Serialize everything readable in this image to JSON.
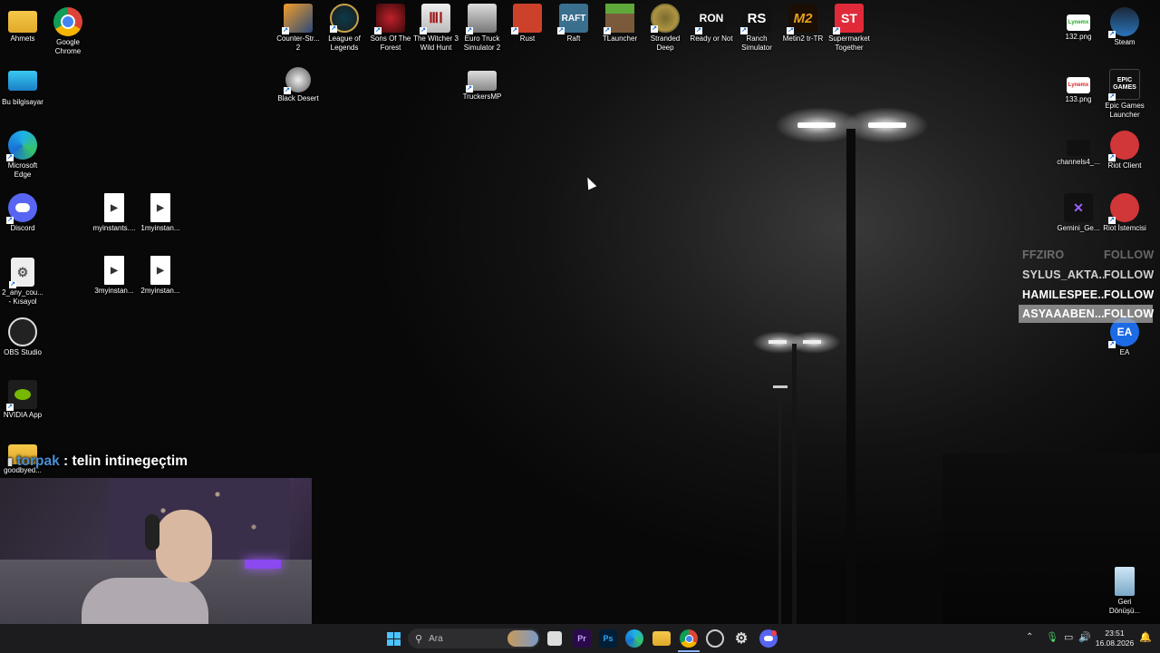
{
  "desktop": {
    "left_icons": [
      {
        "label": "Ahmets",
        "icon": "folder-icon"
      },
      {
        "label": "Google Chrome",
        "icon": "chrome-icon"
      },
      {
        "label": "Bu bilgisayar",
        "icon": "monitor-icon"
      },
      {
        "label": "Microsoft Edge",
        "icon": "edge-icon"
      },
      {
        "label": "Discord",
        "icon": "discord-icon"
      },
      {
        "label": "myinstants....",
        "icon": "media-file-icon"
      },
      {
        "label": "1myinstan...",
        "icon": "media-file-icon"
      },
      {
        "label": "2_any_cou... - Kısayol",
        "icon": "settings-file-icon"
      },
      {
        "label": "3myinstan...",
        "icon": "media-file-icon"
      },
      {
        "label": "2myinstan...",
        "icon": "media-file-icon"
      },
      {
        "label": "OBS Studio",
        "icon": "obs-icon"
      },
      {
        "label": "NVIDIA App",
        "icon": "nvidia-icon"
      },
      {
        "label": "goodbyed...",
        "icon": "folder-icon"
      }
    ],
    "top_icons": [
      {
        "label": "Counter-Str... 2",
        "icon": "counter-strike-icon"
      },
      {
        "label": "League of Legends",
        "icon": "league-icon"
      },
      {
        "label": "Sons Of The Forest",
        "icon": "sons-forest-icon"
      },
      {
        "label": "The Witcher 3 Wild Hunt",
        "icon": "witcher-icon"
      },
      {
        "label": "Euro Truck Simulator 2",
        "icon": "truck-icon"
      },
      {
        "label": "Rust",
        "icon": "rust-icon"
      },
      {
        "label": "Raft",
        "icon": "raft-icon"
      },
      {
        "label": "TLauncher",
        "icon": "minecraft-icon"
      },
      {
        "label": "Stranded Deep",
        "icon": "stranded-icon"
      },
      {
        "label": "Ready or Not",
        "icon": "ready-or-not-icon"
      },
      {
        "label": "Ranch Simulator",
        "icon": "ranch-icon"
      },
      {
        "label": "Metin2 tr-TR",
        "icon": "metin-icon"
      },
      {
        "label": "Supermarket Together",
        "icon": "supermarket-icon"
      },
      {
        "label": "Black Desert",
        "icon": "black-desert-icon"
      },
      {
        "label": "TruckersMP",
        "icon": "truckersmp-icon"
      }
    ],
    "right_icons": [
      {
        "label": "132.png",
        "icon": "image-file-icon"
      },
      {
        "label": "Steam",
        "icon": "steam-icon"
      },
      {
        "label": "133.png",
        "icon": "image-file-icon"
      },
      {
        "label": "Epic Games Launcher",
        "icon": "epic-icon"
      },
      {
        "label": "channels4_...",
        "icon": "image-file-icon"
      },
      {
        "label": "Riot Client",
        "icon": "riot-icon"
      },
      {
        "label": "Gemini_Ge...",
        "icon": "image-file-icon"
      },
      {
        "label": "Riot İstemcisi",
        "icon": "riot-icon"
      },
      {
        "label": "EA",
        "icon": "ea-icon"
      },
      {
        "label": "Geri Dönüşü...",
        "icon": "recycle-bin-icon"
      }
    ],
    "icon_texts": {
      "raft": "RAFT",
      "epic": "EPIC GAMES",
      "ea": "EA",
      "ready": "RON",
      "ranch": "RS",
      "metin": "M2",
      "supermarket": "ST",
      "png_brand": "Lynemx"
    }
  },
  "overlay": {
    "follows": [
      {
        "name": "FFZIRO",
        "action": "FOLLOW"
      },
      {
        "name": "SYLUS_AKTA...",
        "action": "FOLLOW"
      },
      {
        "name": "HAMILESPEE...",
        "action": "FOLLOW"
      },
      {
        "name": "ASYAAABEN...",
        "action": "FOLLOW"
      }
    ],
    "chat": {
      "user": "torpak",
      "separator": " : ",
      "message": "telin intinegeçtim"
    }
  },
  "taskbar": {
    "search_placeholder": "Ara",
    "time": "23:51",
    "date": "16.08.2026",
    "icons": [
      "windows-start-icon",
      "search-icon",
      "task-view-icon",
      "premiere-icon",
      "photoshop-icon",
      "edge-icon",
      "file-explorer-icon",
      "chrome-icon",
      "app-icon",
      "app-icon",
      "discord-icon"
    ],
    "pr_text": "Pr",
    "ps_text": "Ps"
  },
  "colors": {
    "chat_user": "#4a8fd6",
    "follow_highlight": "rgba(170,170,170,0.75)",
    "taskbar_bg": "#1c1c1e"
  }
}
